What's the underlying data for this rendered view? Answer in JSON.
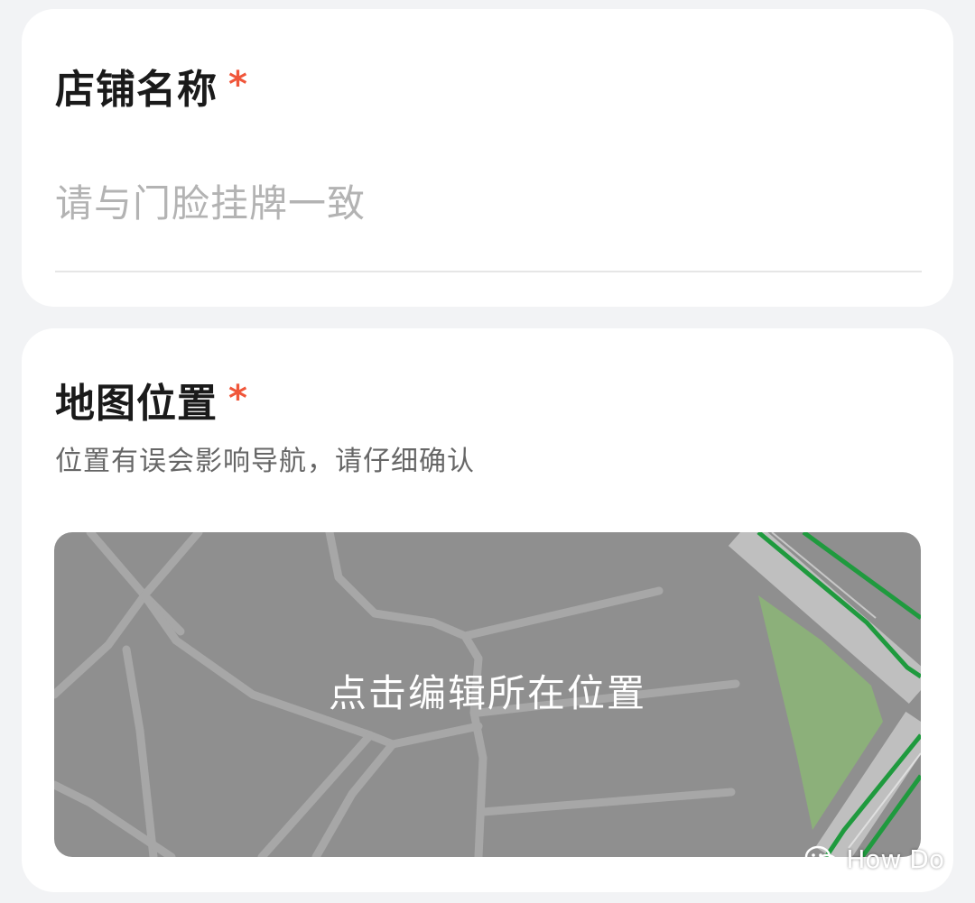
{
  "shop_name_section": {
    "title": "店铺名称",
    "required_mark": "*",
    "placeholder": "请与门脸挂牌一致",
    "value": ""
  },
  "map_section": {
    "title": "地图位置",
    "required_mark": "*",
    "subtitle": "位置有误会影响导航，请仔细确认",
    "map_action_label": "点击编辑所在位置"
  },
  "watermark": {
    "text": "How Do",
    "icon": "wechat-icon"
  },
  "colors": {
    "required": "#f0563a",
    "map_background": "#8f8f8f",
    "park": "#8cb07a",
    "road_green": "#1f9a3e"
  }
}
